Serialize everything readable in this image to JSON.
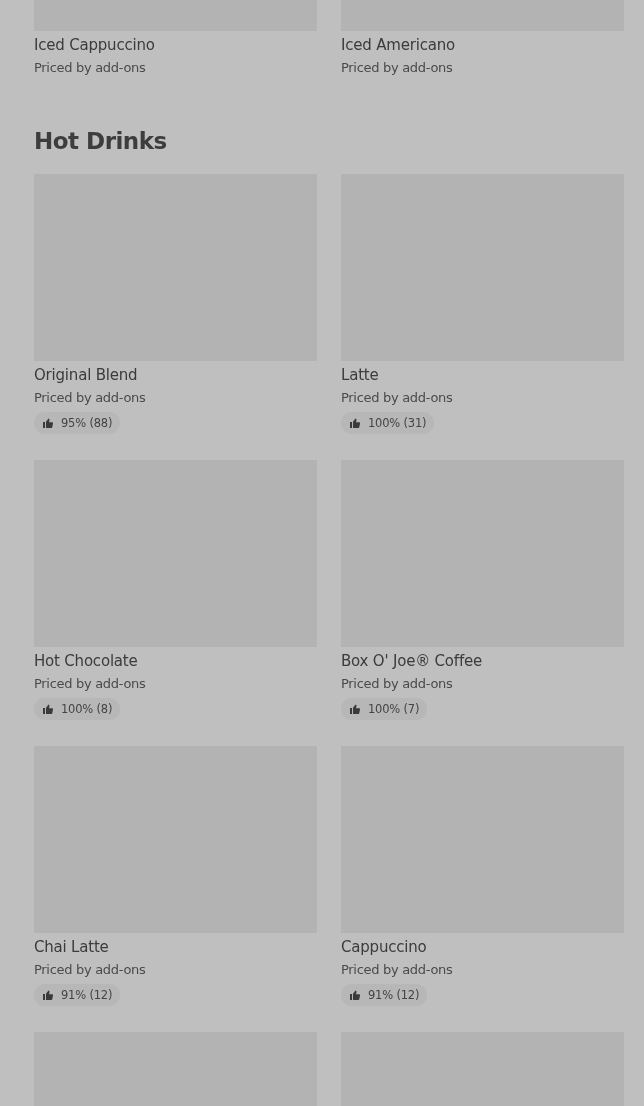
{
  "sections": [
    {
      "items": [
        {
          "image": true,
          "name": "Iced Cappuccino",
          "subtitle": "Priced by add-ons"
        },
        {
          "image": true,
          "name": "Iced Americano",
          "subtitle": "Priced by add-ons"
        }
      ]
    },
    {
      "title": "Hot Drinks",
      "items": [
        {
          "image": true,
          "name": "Original Blend",
          "subtitle": "Priced by add-ons",
          "rating": "95% (88)"
        },
        {
          "image": true,
          "name": "Latte",
          "subtitle": "Priced by add-ons",
          "rating": "100% (31)"
        },
        {
          "image": true,
          "name": "Hot Chocolate",
          "subtitle": "Priced by add-ons",
          "rating": "100% (8)"
        },
        {
          "image": true,
          "name": "Box O' Joe® Coffee",
          "subtitle": "Priced by add-ons",
          "rating": "100% (7)"
        },
        {
          "image": true,
          "name": "Chai Latte",
          "subtitle": "Priced by add-ons",
          "rating": "91% (12)"
        },
        {
          "image": true,
          "name": "Cappuccino",
          "subtitle": "Priced by add-ons",
          "rating": "91% (12)"
        },
        {
          "image": true
        },
        {
          "image": true
        }
      ]
    }
  ]
}
